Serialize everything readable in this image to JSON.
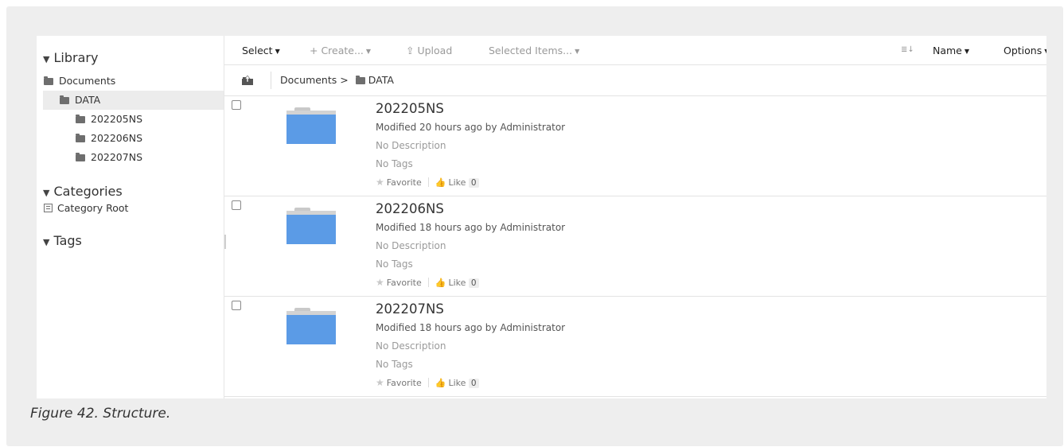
{
  "sidebar": {
    "library": {
      "title": "Library",
      "toggle": "▼"
    },
    "tree": [
      {
        "label": "Documents"
      },
      {
        "label": "DATA"
      },
      {
        "label": "202205NS"
      },
      {
        "label": "202206NS"
      },
      {
        "label": "202207NS"
      }
    ],
    "categories": {
      "title": "Categories",
      "toggle": "▼",
      "root": "Category Root"
    },
    "tags": {
      "title": "Tags",
      "toggle": "▼"
    }
  },
  "toolbar": {
    "select": "Select",
    "create": "+ Create...",
    "upload": "Upload",
    "selected_items": "Selected Items...",
    "sort_name": "Name",
    "options": "Options"
  },
  "breadcrumb": {
    "path": "Documents >",
    "current": "DATA"
  },
  "items": [
    {
      "name": "202205NS",
      "modified": "Modified 20 hours ago by Administrator",
      "description": "No Description",
      "tags": "No Tags",
      "favorite": "Favorite",
      "like": "Like",
      "like_count": "0"
    },
    {
      "name": "202206NS",
      "modified": "Modified 18 hours ago by Administrator",
      "description": "No Description",
      "tags": "No Tags",
      "favorite": "Favorite",
      "like": "Like",
      "like_count": "0"
    },
    {
      "name": "202207NS",
      "modified": "Modified 18 hours ago by Administrator",
      "description": "No Description",
      "tags": "No Tags",
      "favorite": "Favorite",
      "like": "Like",
      "like_count": "0"
    }
  ],
  "caption": "Figure 42. Structure.",
  "colors": {
    "folder_blue": "#5b9be6",
    "selected_bg": "#ececec",
    "frame_bg": "#eeeeee"
  }
}
